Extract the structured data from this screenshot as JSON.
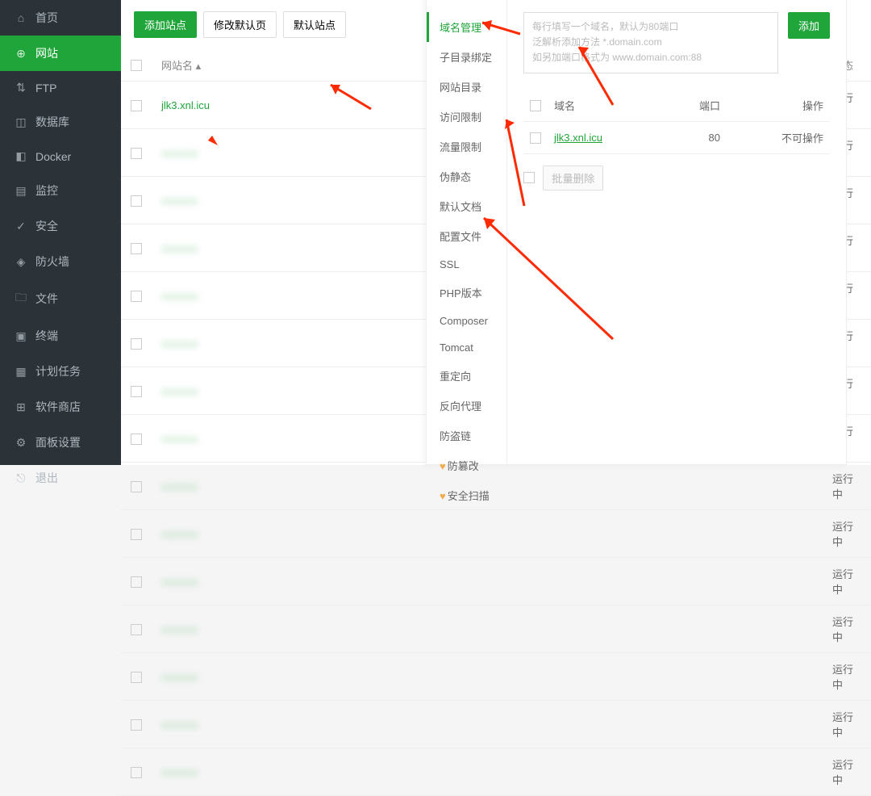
{
  "sidebar": {
    "items": [
      {
        "icon": "⌂",
        "label": "首页"
      },
      {
        "icon": "⊕",
        "label": "网站"
      },
      {
        "icon": "⇅",
        "label": "FTP"
      },
      {
        "icon": "◫",
        "label": "数据库"
      },
      {
        "icon": "◧",
        "label": "Docker"
      },
      {
        "icon": "▤",
        "label": "监控"
      },
      {
        "icon": "✓",
        "label": "安全"
      },
      {
        "icon": "◈",
        "label": "防火墙"
      },
      {
        "icon": "🗀",
        "label": "文件"
      },
      {
        "icon": "▣",
        "label": "终端"
      },
      {
        "icon": "▦",
        "label": "计划任务"
      },
      {
        "icon": "⊞",
        "label": "软件商店"
      },
      {
        "icon": "⚙",
        "label": "面板设置"
      },
      {
        "icon": "⎋",
        "label": "退出"
      }
    ],
    "active": 1
  },
  "toolbar": {
    "add_site": "添加站点",
    "edit_default": "修改默认页",
    "default_site": "默认站点"
  },
  "list": {
    "cols": {
      "name": "网站名 ▴",
      "status": "状态"
    },
    "status_text": "运行中",
    "first_row": "jlk3.xnl.icu",
    "blurred_count": 14
  },
  "modal": {
    "nav": [
      "域名管理",
      "子目录绑定",
      "网站目录",
      "访问限制",
      "流量限制",
      "伪静态",
      "默认文档",
      "配置文件",
      "SSL",
      "PHP版本",
      "Composer",
      "Tomcat",
      "重定向",
      "反向代理",
      "防盗链",
      "防篡改",
      "安全扫描"
    ],
    "nav_active": 0,
    "placeholder_l1": "每行填写一个域名，默认为80端口",
    "placeholder_l2": "泛解析添加方法 *.domain.com",
    "placeholder_l3": "如另加端口格式为 www.domain.com:88",
    "add_btn": "添加",
    "table": {
      "cols": {
        "domain": "域名",
        "port": "端口",
        "op": "操作"
      },
      "rows": [
        {
          "domain": "jlk3.xnl.icu",
          "port": "80",
          "op": "不可操作"
        }
      ]
    },
    "batch_del": "批量删除"
  }
}
